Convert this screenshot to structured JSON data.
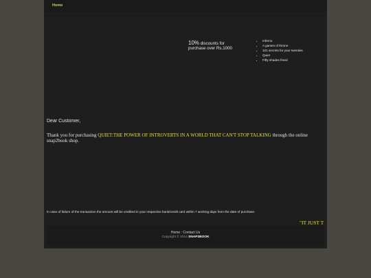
{
  "nav": {
    "home_label": "Home"
  },
  "promo": {
    "percent": "10%",
    "text_line1": " discounts for",
    "text_line2": "purchase over Rs.1000"
  },
  "books": [
    "Inferno",
    "A games of throne",
    "101 secrets for your twenties",
    "Quiet",
    "Fifty shades freed"
  ],
  "message": {
    "greeting": "Dear Customer,",
    "thanks_prefix": "Thank you for purchasing ",
    "book_title": "QUIET:THE POWER OF INTROVERTS IN A WORLD THAT CAN'T STOP TALKING",
    "thanks_suffix": " through the online snap2book shop.",
    "failure_note": "In case of failure of the transaction the amount will be credited in your respective bank/credit card within 7 working days from the date of purchase.",
    "marquee": "\"IT JUST T"
  },
  "footer": {
    "home_link": "Home",
    "separator": " : ",
    "contact_link": "Contact Us",
    "copyright": "Copyright © 2014 ",
    "brand": "SNAP2BOOK"
  },
  "colors": {
    "background": "#4a4642",
    "panel": "#1e1e1e",
    "accent_yellow": "#e4dd57",
    "nav_green": "#c6d66a"
  }
}
